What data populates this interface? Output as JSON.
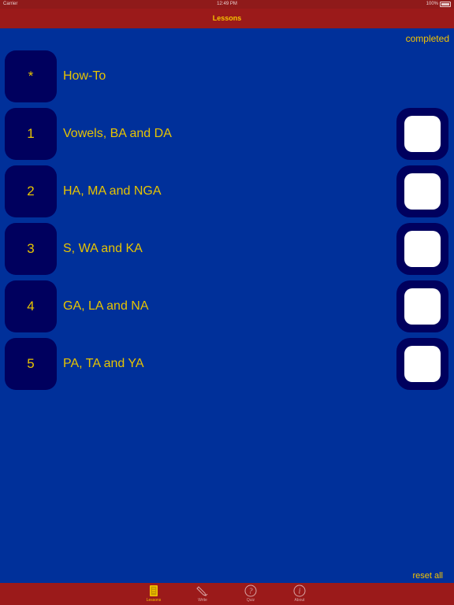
{
  "status_bar": {
    "carrier": "Carrier",
    "time": "12:49 PM",
    "battery": "100%"
  },
  "nav": {
    "title": "Lessons"
  },
  "header": {
    "completed_label": "completed"
  },
  "lessons": [
    {
      "number": "*",
      "title": "How-To",
      "has_checkbox": false
    },
    {
      "number": "1",
      "title": "Vowels, BA and DA",
      "has_checkbox": true
    },
    {
      "number": "2",
      "title": "HA, MA and NGA",
      "has_checkbox": true
    },
    {
      "number": "3",
      "title": "S, WA and KA",
      "has_checkbox": true
    },
    {
      "number": "4",
      "title": "GA, LA and NA",
      "has_checkbox": true
    },
    {
      "number": "5",
      "title": "PA, TA and YA",
      "has_checkbox": true
    }
  ],
  "footer": {
    "reset_label": "reset all"
  },
  "tabs": [
    {
      "label": "Lessons",
      "icon": "book-icon",
      "active": true
    },
    {
      "label": "Write",
      "icon": "pen-icon",
      "active": false
    },
    {
      "label": "Quiz",
      "icon": "question-icon",
      "active": false
    },
    {
      "label": "About",
      "icon": "info-icon",
      "active": false
    }
  ],
  "colors": {
    "background": "#00309a",
    "bar": "#9b1a1a",
    "accent": "#f5c400",
    "tile": "#00005e"
  }
}
